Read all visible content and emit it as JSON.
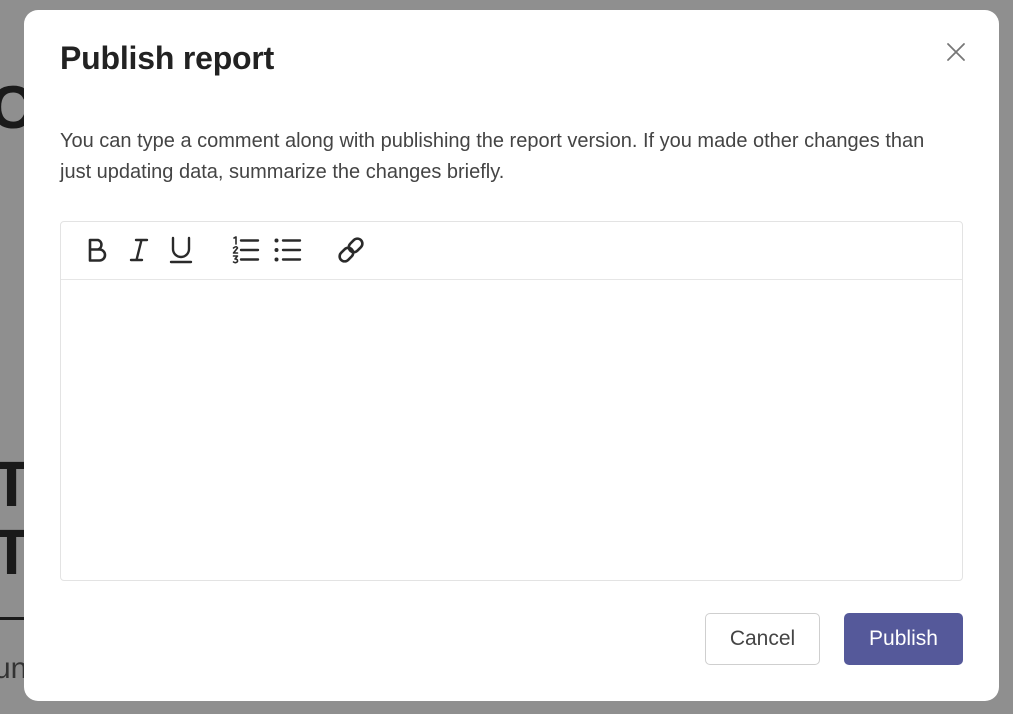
{
  "background": {
    "glyph_c": "C",
    "glyph_t1": "T",
    "glyph_t2": "T",
    "text_un": "un"
  },
  "modal": {
    "title": "Publish report",
    "close_icon": "close-icon",
    "description": "You can type a comment along with publishing the report version. If you made other changes than just updating data, summarize the changes briefly.",
    "editor": {
      "toolbar": [
        {
          "name": "bold-icon",
          "title": "Bold"
        },
        {
          "name": "italic-icon",
          "title": "Italic"
        },
        {
          "name": "underline-icon",
          "title": "Underline"
        },
        {
          "name": "ordered-list-icon",
          "title": "Numbered list"
        },
        {
          "name": "bullet-list-icon",
          "title": "Bulleted list"
        },
        {
          "name": "link-icon",
          "title": "Link"
        }
      ],
      "content": ""
    },
    "buttons": {
      "cancel": "Cancel",
      "publish": "Publish"
    }
  },
  "colors": {
    "primary": "#55599a",
    "overlay": "#8f8f8f",
    "text": "#222222"
  }
}
